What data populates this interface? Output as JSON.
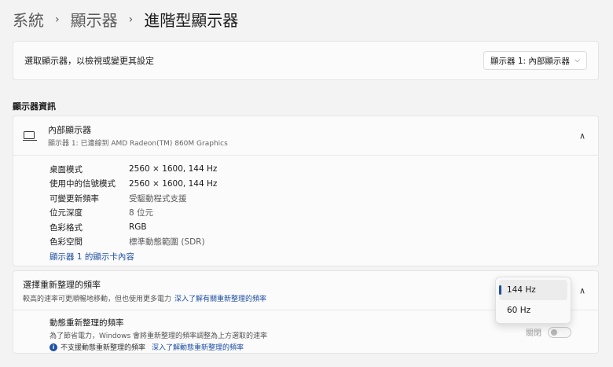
{
  "breadcrumb": {
    "level1": "系統",
    "level2": "顯示器",
    "level3": "進階型顯示器",
    "separator": "›"
  },
  "display_select": {
    "label": "選取顯示器，以檢視或變更其設定",
    "selected_value": "顯示器 1: 內部顯示器"
  },
  "section_title": "顯示器資訊",
  "display_info": {
    "title": "內部顯示器",
    "subtitle": "顯示器 1: 已連線到 AMD Radeon(TM) 860M Graphics",
    "rows": [
      {
        "key": "桌面模式",
        "value": "2560 × 1600, 144 Hz"
      },
      {
        "key": "使用中的信號模式",
        "value": "2560 × 1600, 144 Hz"
      },
      {
        "key": "可變更新頻率",
        "value": "受驅動程式支援"
      },
      {
        "key": "位元深度",
        "value": "8 位元"
      },
      {
        "key": "色彩格式",
        "value": "RGB"
      },
      {
        "key": "色彩空間",
        "value": "標準動態範圍 (SDR)"
      }
    ],
    "adapter_link": "顯示器 1 的顯示卡內容"
  },
  "refresh_rate": {
    "title": "選擇重新整理的頻率",
    "subtitle": "較高的速率可更順暢地移動，但也使用更多電力",
    "link": "深入了解有關重新整理的頻率",
    "options": [
      "144 Hz",
      "60 Hz"
    ],
    "selected": "144 Hz"
  },
  "dynamic_refresh": {
    "title": "動態重新整理的頻率",
    "subtitle": "為了節省電力，Windows 會將重新整理的頻率調整為上方選取的速率",
    "warning": "不支援動態重新整理的頻率",
    "warning_link": "深入了解動態重新整理的頻率",
    "toggle_label": "關閉",
    "toggle_on": false
  },
  "colors": {
    "accent": "#1f4fa3",
    "background": "#f3f3f3",
    "card": "#fbfbfb"
  }
}
